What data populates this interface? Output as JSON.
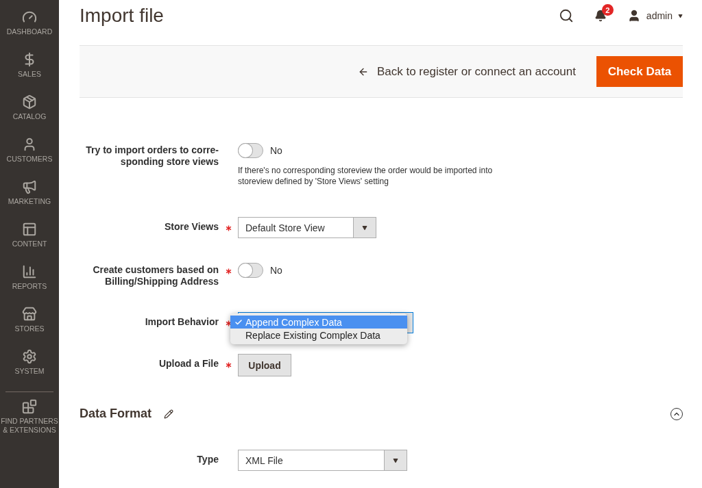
{
  "sidebar": {
    "items": [
      {
        "label": "DASHBOARD"
      },
      {
        "label": "SALES"
      },
      {
        "label": "CATALOG"
      },
      {
        "label": "CUSTOMERS"
      },
      {
        "label": "MARKETING"
      },
      {
        "label": "CONTENT"
      },
      {
        "label": "REPORTS"
      },
      {
        "label": "STORES"
      },
      {
        "label": "SYSTEM"
      },
      {
        "label": "FIND PARTNERS & EXTENSIONS"
      }
    ]
  },
  "header": {
    "title": "Import file",
    "notifications": "2",
    "user": "admin"
  },
  "toolbar": {
    "back_link": "Back to register or connect an account",
    "primary_button": "Check Data"
  },
  "fields": [
    {
      "kind": "toggle",
      "label": "Try to import orders to corre-\nsponding store views",
      "required": false,
      "on": false,
      "value": "No",
      "note": "If there's no corresponding storeview the order would be imported into storeview defined by 'Store Views' setting"
    },
    {
      "kind": "select",
      "label": "Store Views",
      "required": true,
      "value": "Default Store View"
    },
    {
      "kind": "toggle",
      "label": "Create customers based on\nBilling/Shipping Address",
      "required": true,
      "on": false,
      "value": "No"
    },
    {
      "kind": "menu",
      "label": "Import Behavior",
      "required": true,
      "options": [
        {
          "label": "Append Complex Data",
          "selected": true
        },
        {
          "label": "Replace Existing Complex Data",
          "selected": false
        }
      ]
    },
    {
      "kind": "upload",
      "label": "Upload a File",
      "required": true,
      "button": "Upload"
    }
  ],
  "section": {
    "title": "Data Format",
    "expanded": true,
    "fields": [
      {
        "kind": "select",
        "label": "Type",
        "required": false,
        "value": "XML File"
      }
    ]
  }
}
